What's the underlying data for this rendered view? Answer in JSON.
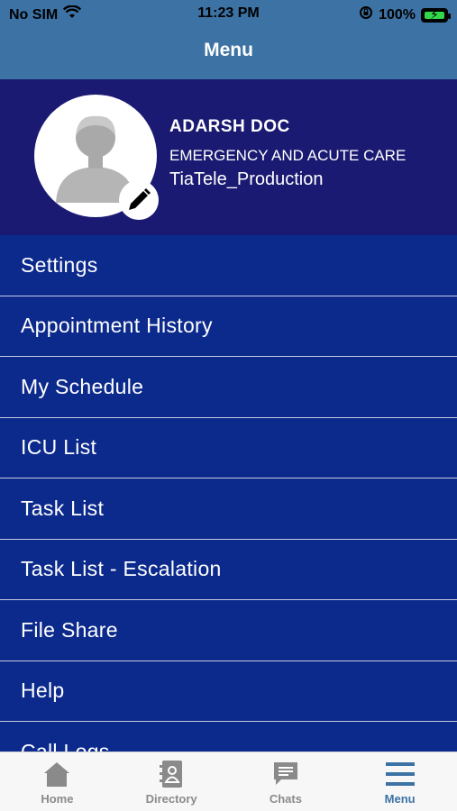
{
  "status_bar": {
    "carrier": "No SIM",
    "time": "11:23 PM",
    "battery": "100%"
  },
  "header": {
    "title": "Menu"
  },
  "profile": {
    "name": "ADARSH  DOC",
    "department": "EMERGENCY AND ACUTE CARE",
    "organization": "TiaTele_Production"
  },
  "menu": {
    "items": [
      {
        "label": "Settings"
      },
      {
        "label": "Appointment History"
      },
      {
        "label": "My Schedule"
      },
      {
        "label": "ICU List"
      },
      {
        "label": "Task List"
      },
      {
        "label": "Task List - Escalation"
      },
      {
        "label": "File Share"
      },
      {
        "label": "Help"
      },
      {
        "label": "Call Logs"
      }
    ]
  },
  "tabbar": {
    "tabs": [
      {
        "label": "Home",
        "icon": "home-icon"
      },
      {
        "label": "Directory",
        "icon": "directory-icon"
      },
      {
        "label": "Chats",
        "icon": "chat-icon"
      },
      {
        "label": "Menu",
        "icon": "menu-icon",
        "active": true
      }
    ]
  },
  "colors": {
    "header": "#3d72a4",
    "profile_bg": "#1a1a72",
    "menu_bg": "#0c2a8c",
    "active_tab": "#3d72a4"
  }
}
